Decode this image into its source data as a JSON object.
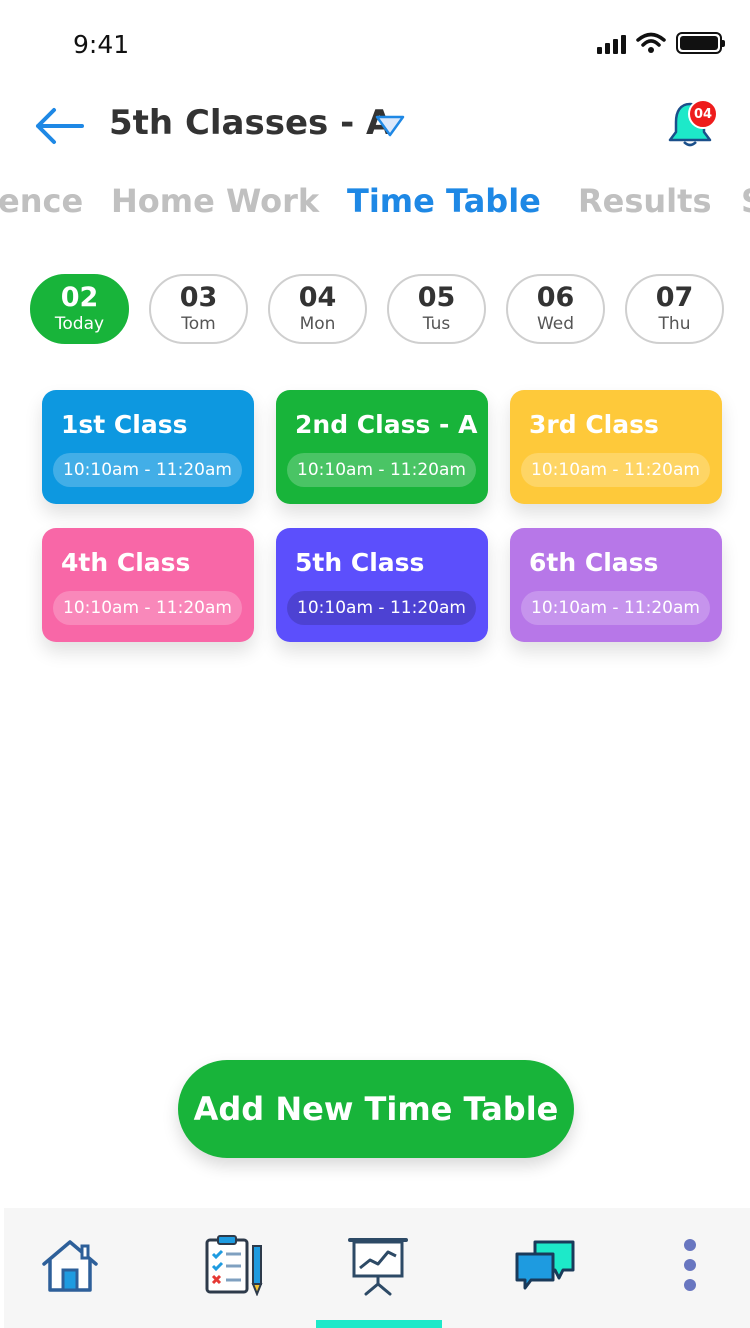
{
  "status_bar": {
    "time": "9:41"
  },
  "header": {
    "title": "5th Classes - A",
    "notification_count": "04"
  },
  "tabs": [
    {
      "label": "Attendence",
      "visible_label": "ence"
    },
    {
      "label": "Home Work"
    },
    {
      "label": "Time Table",
      "active": true
    },
    {
      "label": "Results"
    },
    {
      "label": "S"
    }
  ],
  "dates": [
    {
      "num": "02",
      "day": "Today",
      "active": true
    },
    {
      "num": "03",
      "day": "Tom"
    },
    {
      "num": "04",
      "day": "Mon"
    },
    {
      "num": "05",
      "day": "Tus"
    },
    {
      "num": "06",
      "day": "Wed"
    },
    {
      "num": "07",
      "day": "Thu"
    }
  ],
  "classes": [
    {
      "title": "1st Class",
      "time": "10:10am - 11:20am",
      "color": "#0d98e0"
    },
    {
      "title": "2nd Class - A",
      "time": "10:10am - 11:20am",
      "color": "#18b43a"
    },
    {
      "title": "3rd Class",
      "time": "10:10am - 11:20am",
      "color": "#fec93a"
    },
    {
      "title": "4th Class",
      "time": "10:10am - 11:20am",
      "color": "#f867a7"
    },
    {
      "title": "5th Class",
      "time": "10:10am - 11:20am",
      "color": "#5c4ffc"
    },
    {
      "title": "6th Class",
      "time": "10:10am - 11:20am",
      "color": "#b777e8"
    }
  ],
  "add_button": {
    "label": "Add New Time Table"
  },
  "bottom_nav": [
    {
      "icon": "home-icon"
    },
    {
      "icon": "clipboard-checklist-icon"
    },
    {
      "icon": "presentation-chart-icon",
      "active": true
    },
    {
      "icon": "chat-bubbles-icon"
    },
    {
      "icon": "more-vertical-icon"
    }
  ],
  "colors": {
    "accent_blue": "#1e88e5",
    "accent_green": "#18b43a",
    "badge_red": "#ee1c1c",
    "nav_indicator": "#1de9c9"
  }
}
